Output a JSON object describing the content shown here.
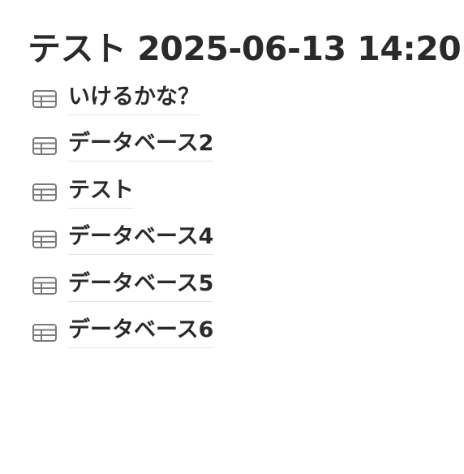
{
  "page": {
    "title": "テスト 2025-06-13 14:20"
  },
  "databases": [
    {
      "label": "いけるかな？",
      "icon": "table-icon"
    },
    {
      "label": "データベース2",
      "icon": "table-icon"
    },
    {
      "label": "テスト",
      "icon": "table-icon"
    },
    {
      "label": "データベース4",
      "icon": "table-icon"
    },
    {
      "label": "データベース5",
      "icon": "table-icon"
    },
    {
      "label": "データベース6",
      "icon": "table-icon"
    }
  ],
  "colors": {
    "text": "#2a2a2a",
    "icon": "#7a7a7a",
    "underline": "#e3e3e3",
    "background": "#ffffff"
  }
}
